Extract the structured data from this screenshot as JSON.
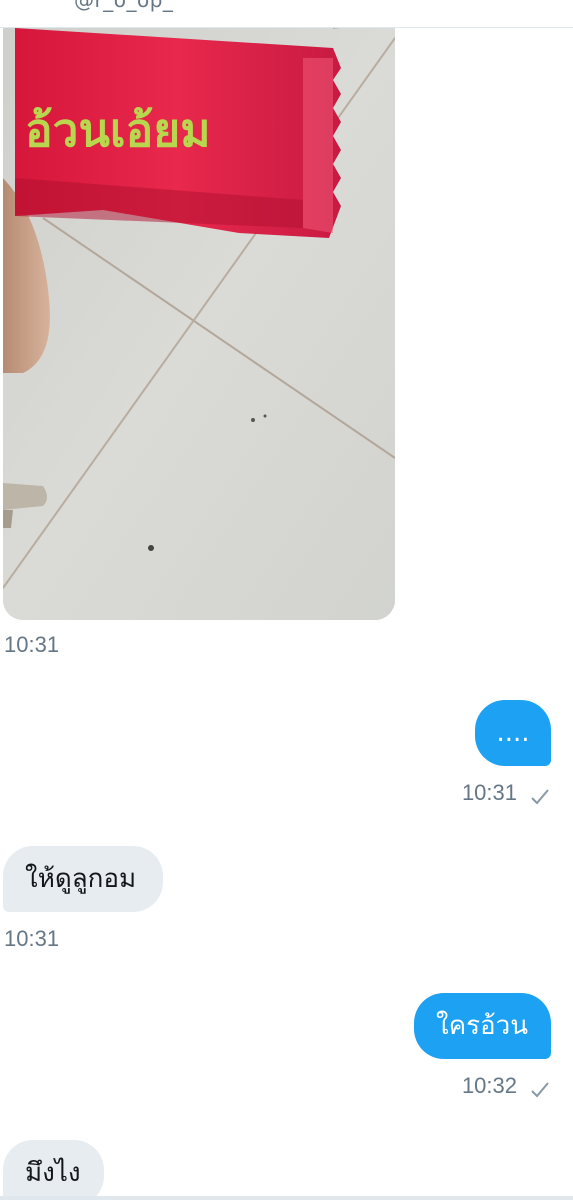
{
  "header": {
    "handle": "@r_o_op_"
  },
  "messages": [
    {
      "type": "image",
      "direction": "in",
      "image_text": "อ้วนเอ้ยม",
      "time": "10:31"
    },
    {
      "type": "text",
      "direction": "out",
      "text": "....",
      "time": "10:31",
      "status_icon": "check-icon"
    },
    {
      "type": "text",
      "direction": "in",
      "text": "ให้ดูลูกอม",
      "time": "10:31"
    },
    {
      "type": "text",
      "direction": "out",
      "text": "ใครอ้วน",
      "time": "10:32",
      "status_icon": "check-icon"
    },
    {
      "type": "text",
      "direction": "in",
      "text": "มึงไง"
    }
  ],
  "colors": {
    "outgoing_bubble": "#1da1f2",
    "incoming_bubble": "#e6ecf0",
    "timestamp": "#657786"
  }
}
